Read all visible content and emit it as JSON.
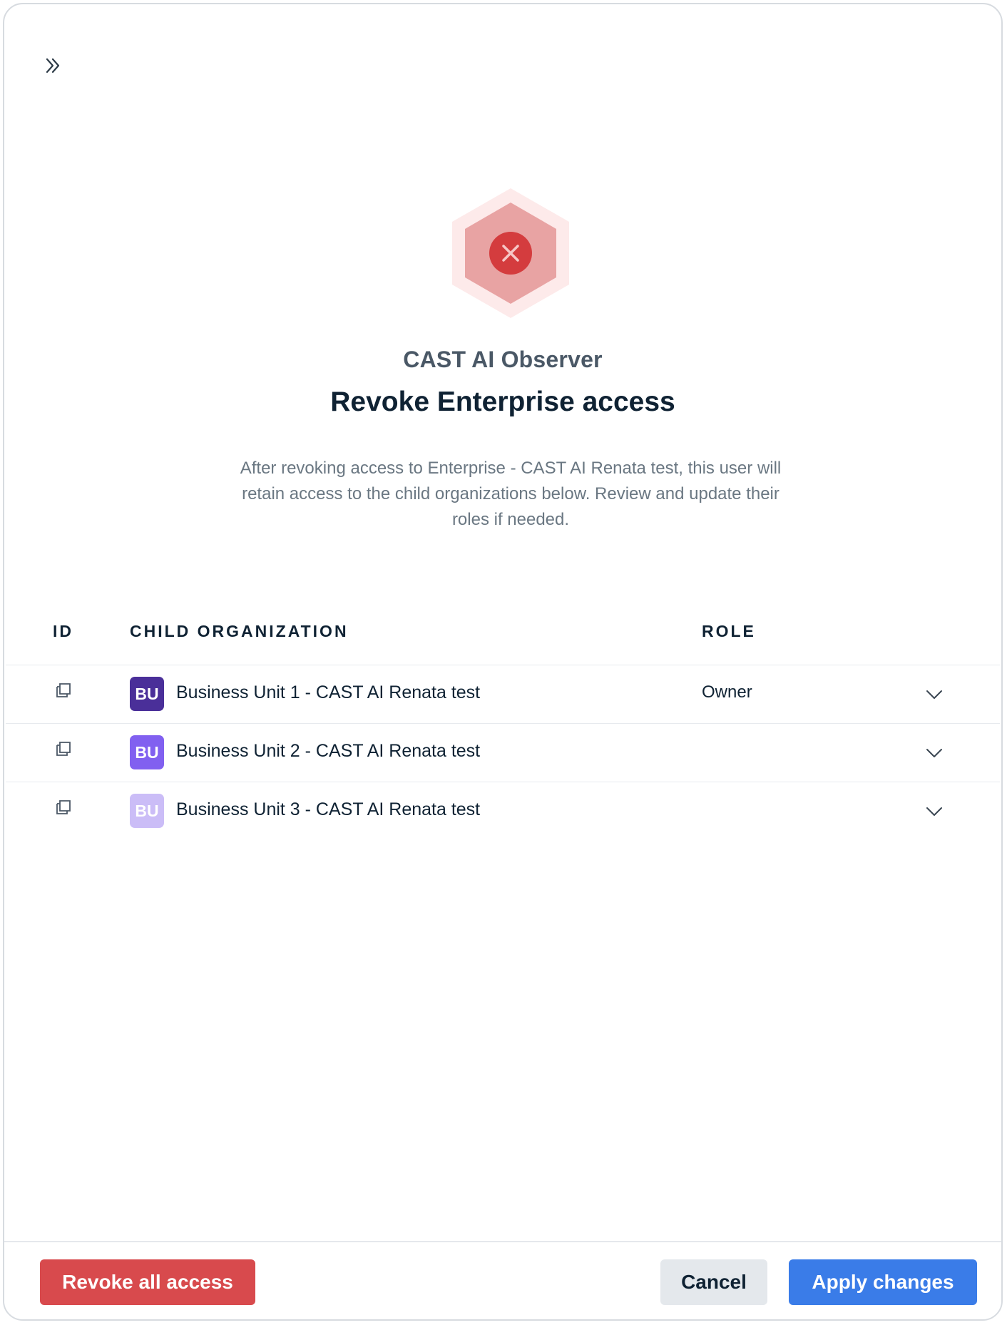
{
  "header": {
    "collapse_icon": "double-chevron-right-icon"
  },
  "hero": {
    "icon": "close-icon",
    "colors": {
      "outer": "#fdeaea",
      "inner": "#e8a3a3",
      "circle": "#d43c3e"
    }
  },
  "app_name": "CAST AI Observer",
  "title": "Revoke Enterprise access",
  "description": "After revoking access to Enterprise - CAST AI Renata test, this user will retain access to the child organizations below. Review and update their roles if needed.",
  "table": {
    "columns": {
      "id": "ID",
      "child_org": "CHILD ORGANIZATION",
      "role": "ROLE"
    },
    "rows": [
      {
        "badge": "BU",
        "badge_color": "#4a2f99",
        "name": "Business Unit 1 - CAST AI Renata test",
        "role": "Owner"
      },
      {
        "badge": "BU",
        "badge_color": "#8160f0",
        "name": "Business Unit 2 - CAST AI Renata test",
        "role": ""
      },
      {
        "badge": "BU",
        "badge_color": "#cbbdf7",
        "name": "Business Unit 3 - CAST AI Renata test",
        "role": ""
      }
    ]
  },
  "footer": {
    "revoke_label": "Revoke all access",
    "cancel_label": "Cancel",
    "apply_label": "Apply changes"
  }
}
